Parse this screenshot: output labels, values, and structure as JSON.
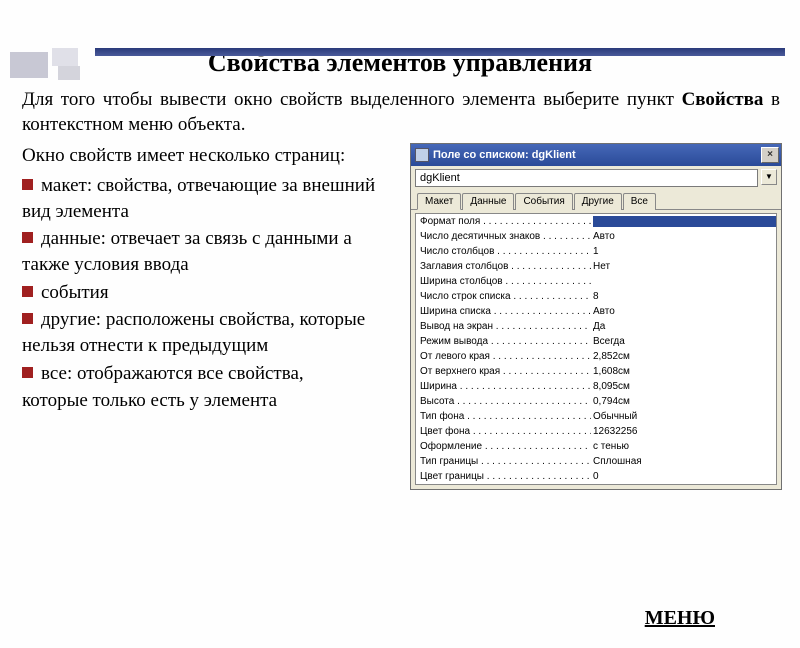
{
  "title": "Свойства элементов управления",
  "intro_before": "Для того чтобы вывести окно свойств выделенного элемента выберите пункт ",
  "intro_bold": "Свойства",
  "intro_after": " в контекстном меню объекта.",
  "subintro": "Окно свойств имеет несколько страниц:",
  "bullets": [
    "макет: свойства, отвечающие за внешний вид элемента",
    "данные: отвечает за связь с данными а также условия ввода",
    "события",
    "другие: расположены свойства, которые нельзя отнести к предыдущим",
    "все: отображаются все свойства,"
  ],
  "afterlist": "которые только есть у элемента",
  "menu_link": "МЕНЮ",
  "window": {
    "title": "Поле со списком: dgKlient",
    "selector_value": "dgKlient",
    "tabs": [
      "Макет",
      "Данные",
      "События",
      "Другие",
      "Все"
    ],
    "props": [
      {
        "label": "Формат поля",
        "value": "",
        "dots": true,
        "highlighted": true
      },
      {
        "label": "Число десятичных знаков",
        "value": "Авто",
        "dots": true
      },
      {
        "label": "Число столбцов",
        "value": "1",
        "dots": true
      },
      {
        "label": "Заглавия столбцов",
        "value": "Нет",
        "dots": true
      },
      {
        "label": "Ширина столбцов",
        "value": "",
        "dots": true
      },
      {
        "label": "Число строк списка",
        "value": "8",
        "dots": true
      },
      {
        "label": "Ширина списка",
        "value": "Авто",
        "dots": true
      },
      {
        "label": "Вывод на экран",
        "value": "Да",
        "dots": true
      },
      {
        "label": "Режим вывода",
        "value": "Всегда",
        "dots": true
      },
      {
        "label": "От левого края",
        "value": "2,852см",
        "dots": true
      },
      {
        "label": "От верхнего края",
        "value": "1,608см",
        "dots": true
      },
      {
        "label": "Ширина",
        "value": "8,095см",
        "dots": true
      },
      {
        "label": "Высота",
        "value": "0,794см",
        "dots": true
      },
      {
        "label": "Тип фона",
        "value": "Обычный",
        "dots": true
      },
      {
        "label": "Цвет фона",
        "value": "12632256",
        "dots": true
      },
      {
        "label": "Оформление",
        "value": "с тенью",
        "dots": true
      },
      {
        "label": "Тип границы",
        "value": "Сплошная",
        "dots": true
      },
      {
        "label": "Цвет границы",
        "value": "0",
        "dots": true
      }
    ]
  }
}
